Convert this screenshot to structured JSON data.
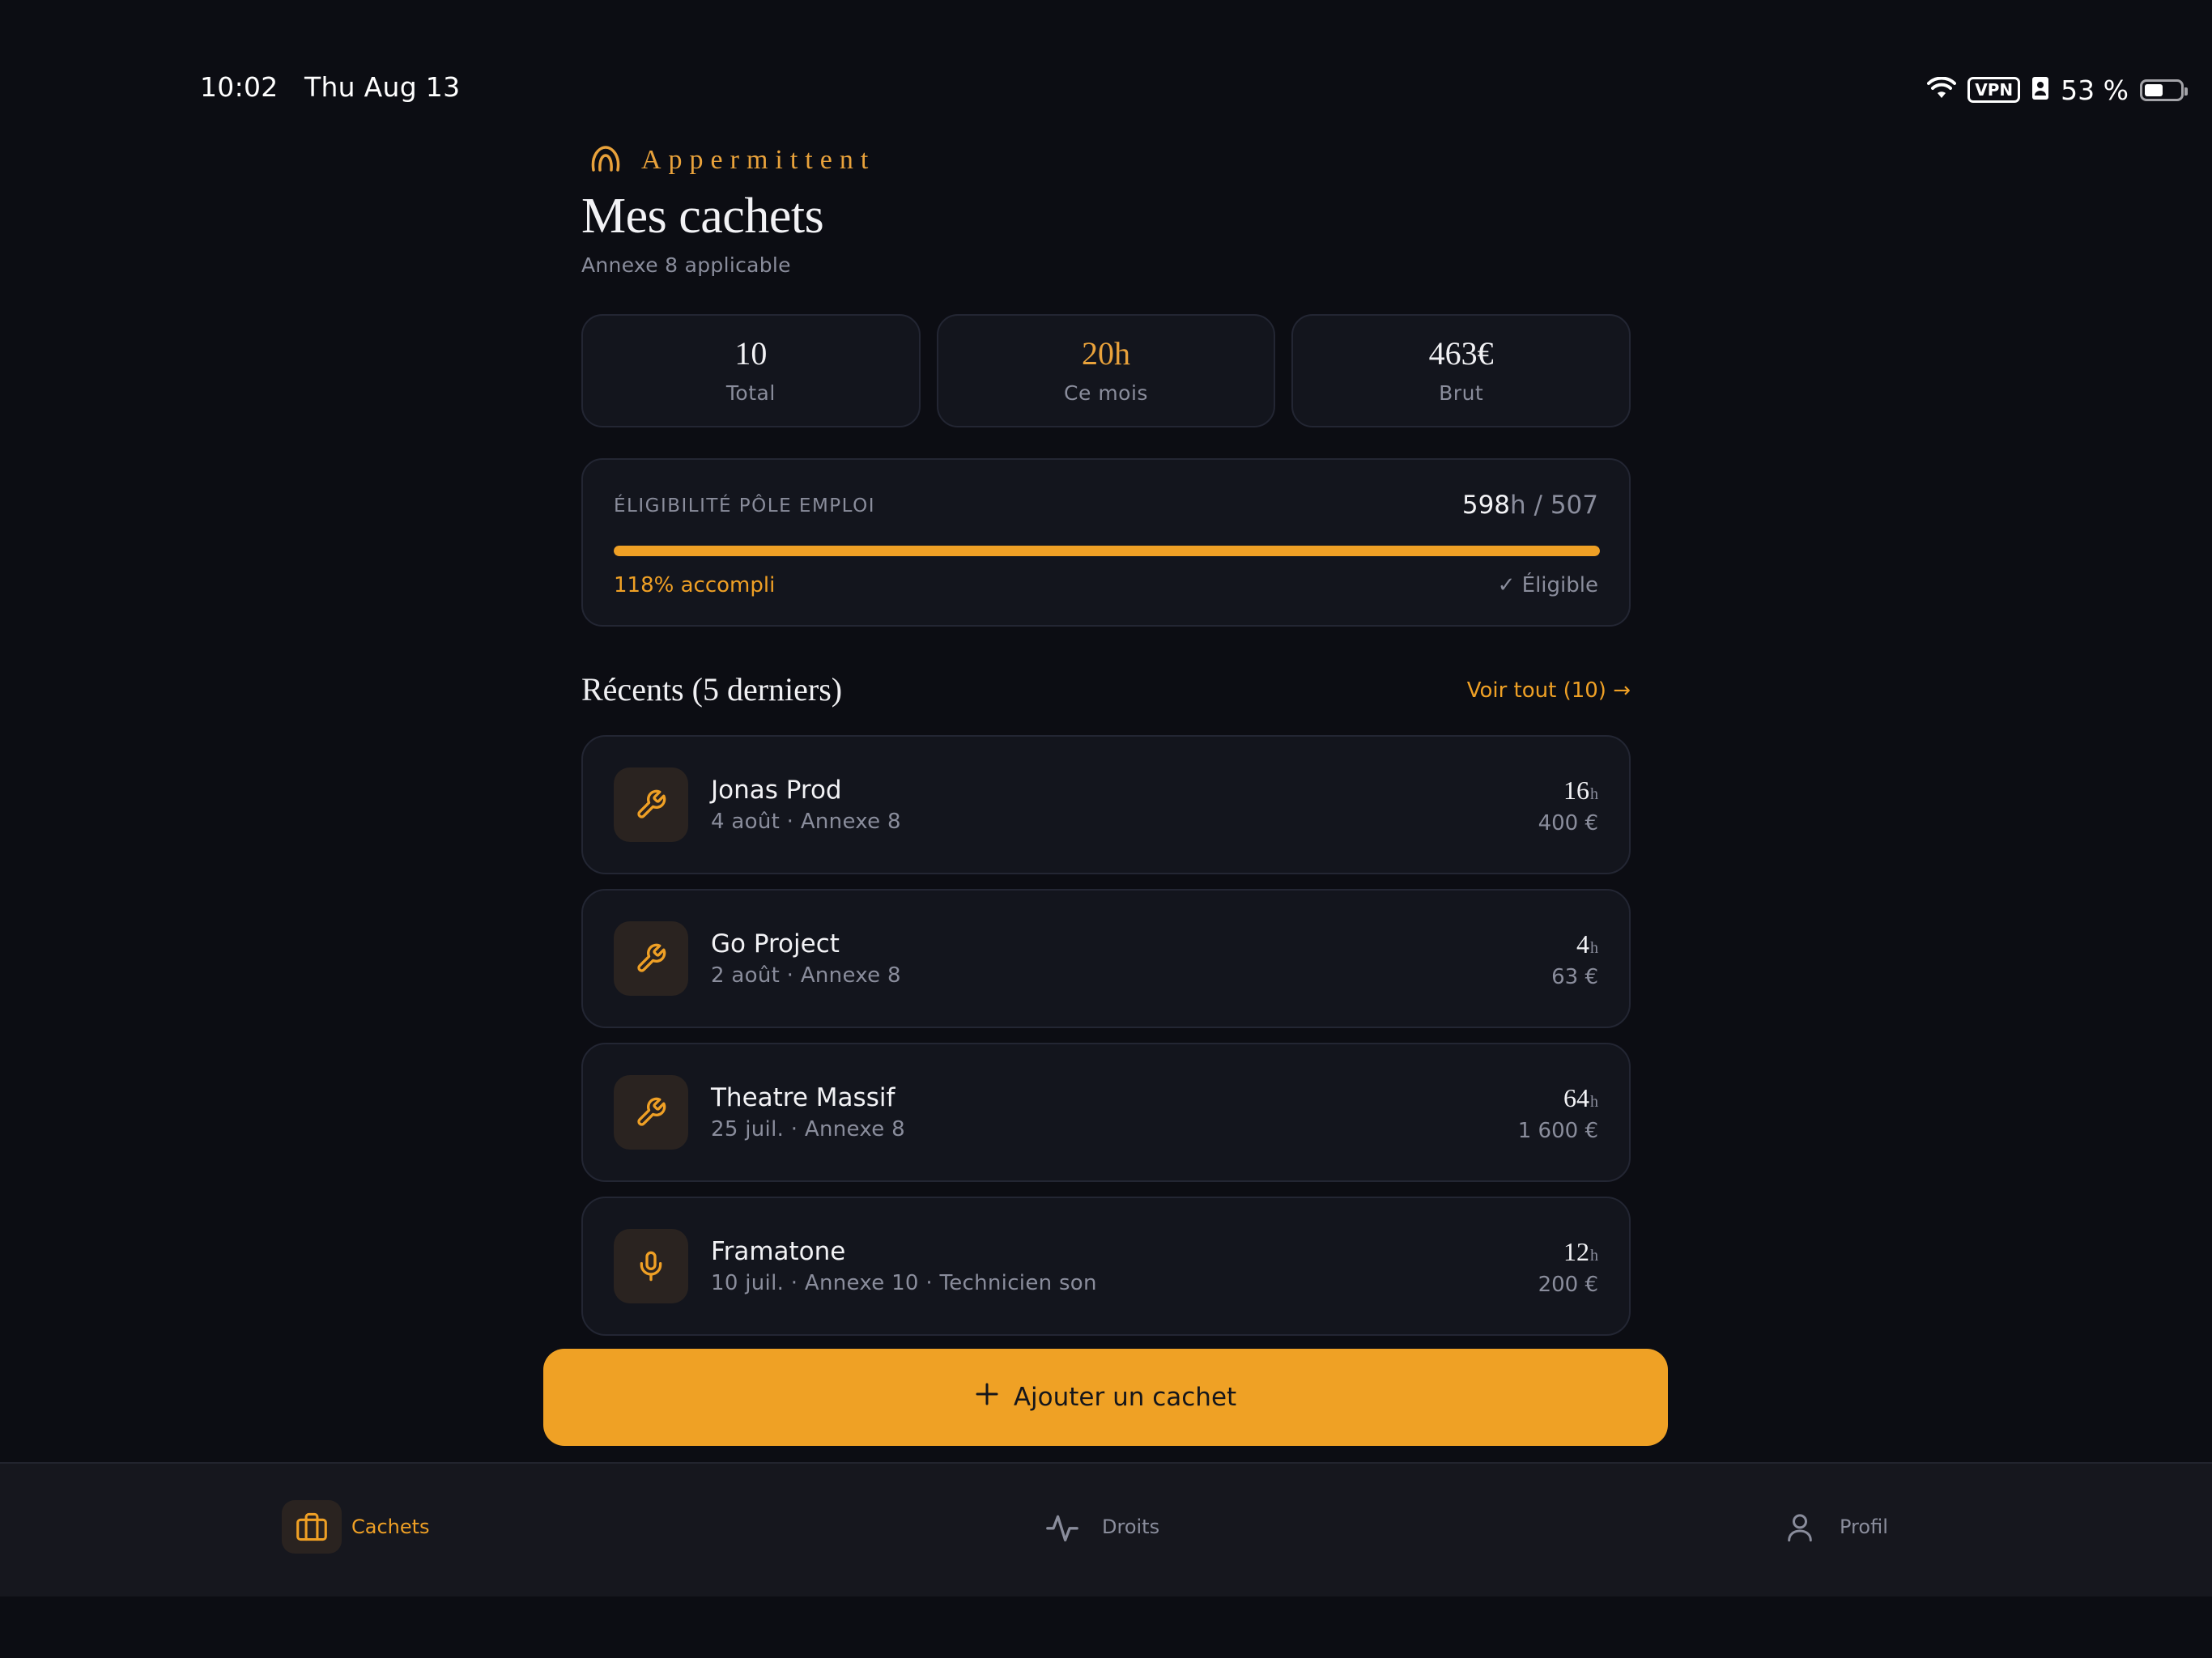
{
  "status_bar": {
    "time": "10:02",
    "date": "Thu Aug 13",
    "vpn": "VPN",
    "battery": "53 %",
    "battery_level": 0.53
  },
  "brand": {
    "name": "Appermittent"
  },
  "page": {
    "title": "Mes cachets",
    "subtitle": "Annexe 8 applicable"
  },
  "stats": [
    {
      "value": "10",
      "label": "Total",
      "accent": false
    },
    {
      "value": "20h",
      "label": "Ce mois",
      "accent": true
    },
    {
      "value": "463€",
      "label": "Brut",
      "accent": false
    }
  ],
  "eligibility": {
    "title": "ÉLIGIBILITÉ PÔLE EMPLOI",
    "hours": "598",
    "hours_suffix": "h / 507",
    "progress_fraction": 1.0,
    "percent_label": "118% accompli",
    "status": "✓ Éligible",
    "accent_color": "#efa025"
  },
  "recent": {
    "title": "Récents (5 derniers)",
    "see_all": "Voir tout (10) →",
    "items": [
      {
        "name": "Jonas Prod",
        "meta": "4 août · Annexe 8",
        "hours": "16",
        "unit": "h",
        "amount": "400 €",
        "icon": "wrench-icon"
      },
      {
        "name": "Go Project",
        "meta": "2 août · Annexe 8",
        "hours": "4",
        "unit": "h",
        "amount": "63 €",
        "icon": "wrench-icon"
      },
      {
        "name": "Theatre Massif",
        "meta": "25 juil. · Annexe 8",
        "hours": "64",
        "unit": "h",
        "amount": "1 600 €",
        "icon": "wrench-icon"
      },
      {
        "name": "Framatone",
        "meta": "10 juil. · Annexe 10 · Technicien son",
        "hours": "12",
        "unit": "h",
        "amount": "200 €",
        "icon": "microphone-icon"
      }
    ]
  },
  "add_button": {
    "label": "Ajouter un cachet",
    "icon": "plus-icon"
  },
  "tabs": [
    {
      "label": "Cachets",
      "icon": "briefcase-icon",
      "active": true
    },
    {
      "label": "Droits",
      "icon": "activity-icon",
      "active": false
    },
    {
      "label": "Profil",
      "icon": "user-icon",
      "active": false
    }
  ]
}
